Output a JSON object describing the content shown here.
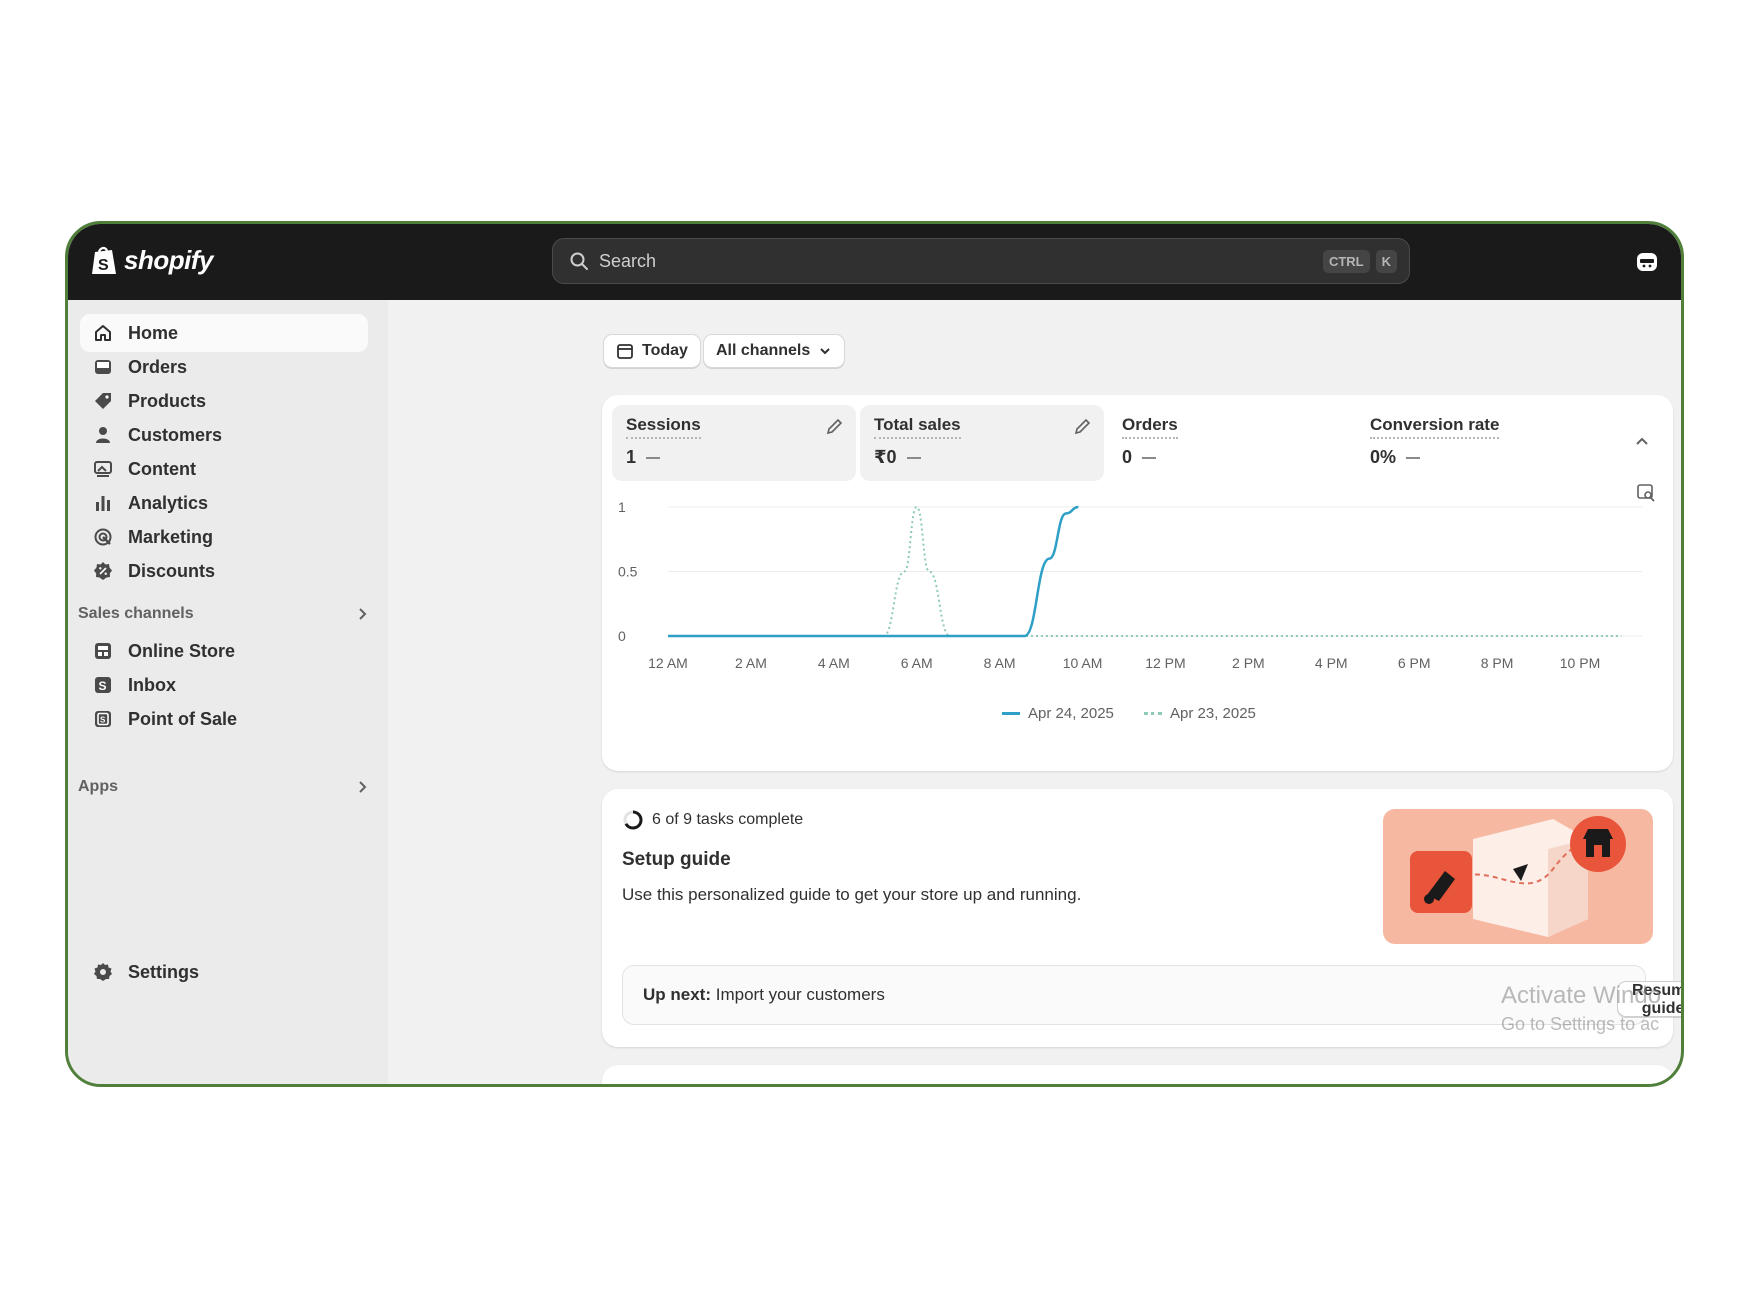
{
  "app": {
    "logo_text": "shopify"
  },
  "search": {
    "placeholder": "Search",
    "shortcut_keys": [
      "CTRL",
      "K"
    ]
  },
  "sidebar": {
    "items": [
      {
        "label": "Home",
        "icon": "home-icon",
        "active": true
      },
      {
        "label": "Orders",
        "icon": "inbox-tray-icon"
      },
      {
        "label": "Products",
        "icon": "tag-icon"
      },
      {
        "label": "Customers",
        "icon": "person-icon"
      },
      {
        "label": "Content",
        "icon": "image-icon"
      },
      {
        "label": "Analytics",
        "icon": "bar-chart-icon"
      },
      {
        "label": "Marketing",
        "icon": "target-icon"
      },
      {
        "label": "Discounts",
        "icon": "discount-icon"
      }
    ],
    "sales_channels": {
      "label": "Sales channels",
      "items": [
        {
          "label": "Online Store",
          "icon": "store-icon"
        },
        {
          "label": "Inbox",
          "icon": "inbox-app-icon"
        },
        {
          "label": "Point of Sale",
          "icon": "pos-icon"
        }
      ]
    },
    "apps": {
      "label": "Apps"
    },
    "settings": {
      "label": "Settings",
      "icon": "gear-icon"
    }
  },
  "filters": {
    "date_label": "Today",
    "channel_label": "All channels"
  },
  "metrics": [
    {
      "label": "Sessions",
      "value": "1"
    },
    {
      "label": "Total sales",
      "value": "₹0"
    },
    {
      "label": "Orders",
      "value": "0"
    },
    {
      "label": "Conversion rate",
      "value": "0%"
    }
  ],
  "chart_data": {
    "type": "line",
    "x": [
      "12 AM",
      "2 AM",
      "4 AM",
      "6 AM",
      "8 AM",
      "10 AM",
      "12 PM",
      "2 PM",
      "4 PM",
      "6 PM",
      "8 PM",
      "10 PM"
    ],
    "ylim": [
      0,
      1
    ],
    "yticks": [
      "1",
      "0.5",
      "0"
    ],
    "grid": true,
    "legend_position": "bottom-center",
    "series": [
      {
        "name": "Apr 24, 2025",
        "style": "solid",
        "color": "#2e9fc7",
        "points": [
          [
            0,
            0
          ],
          [
            1,
            0
          ],
          [
            2,
            0
          ],
          [
            3,
            0
          ],
          [
            4,
            0
          ],
          [
            4.3,
            0
          ],
          [
            4.6,
            0.6
          ],
          [
            4.8,
            0.95
          ],
          [
            4.95,
            1
          ]
        ]
      },
      {
        "name": "Apr 23, 2025",
        "style": "dotted",
        "color": "#8fc9b8",
        "points": [
          [
            0,
            0
          ],
          [
            1,
            0
          ],
          [
            2,
            0
          ],
          [
            2.6,
            0
          ],
          [
            2.85,
            0.5
          ],
          [
            3.0,
            1
          ],
          [
            3.15,
            0.5
          ],
          [
            3.4,
            0
          ],
          [
            4,
            0
          ],
          [
            5,
            0
          ],
          [
            6,
            0
          ],
          [
            7,
            0
          ],
          [
            8,
            0
          ],
          [
            9,
            0
          ],
          [
            10,
            0
          ],
          [
            11,
            0
          ],
          [
            11.5,
            0
          ]
        ]
      }
    ]
  },
  "setup": {
    "progress_text": "6 of 9 tasks complete",
    "progress": {
      "done": 6,
      "total": 9
    },
    "title": "Setup guide",
    "description": "Use this personalized guide to get your store up and running.",
    "upnext_prefix": "Up next:",
    "upnext_task": "Import your customers",
    "resume_label": "Resume guide"
  },
  "watermark": {
    "line1": "Activate Windo",
    "line2": "Go to Settings to ac"
  },
  "colors": {
    "accent": "#2e9fc7",
    "topbar": "#1a1a1a",
    "frame_border": "#4f7f3a",
    "illustration_bg": "#f7b8a2"
  }
}
